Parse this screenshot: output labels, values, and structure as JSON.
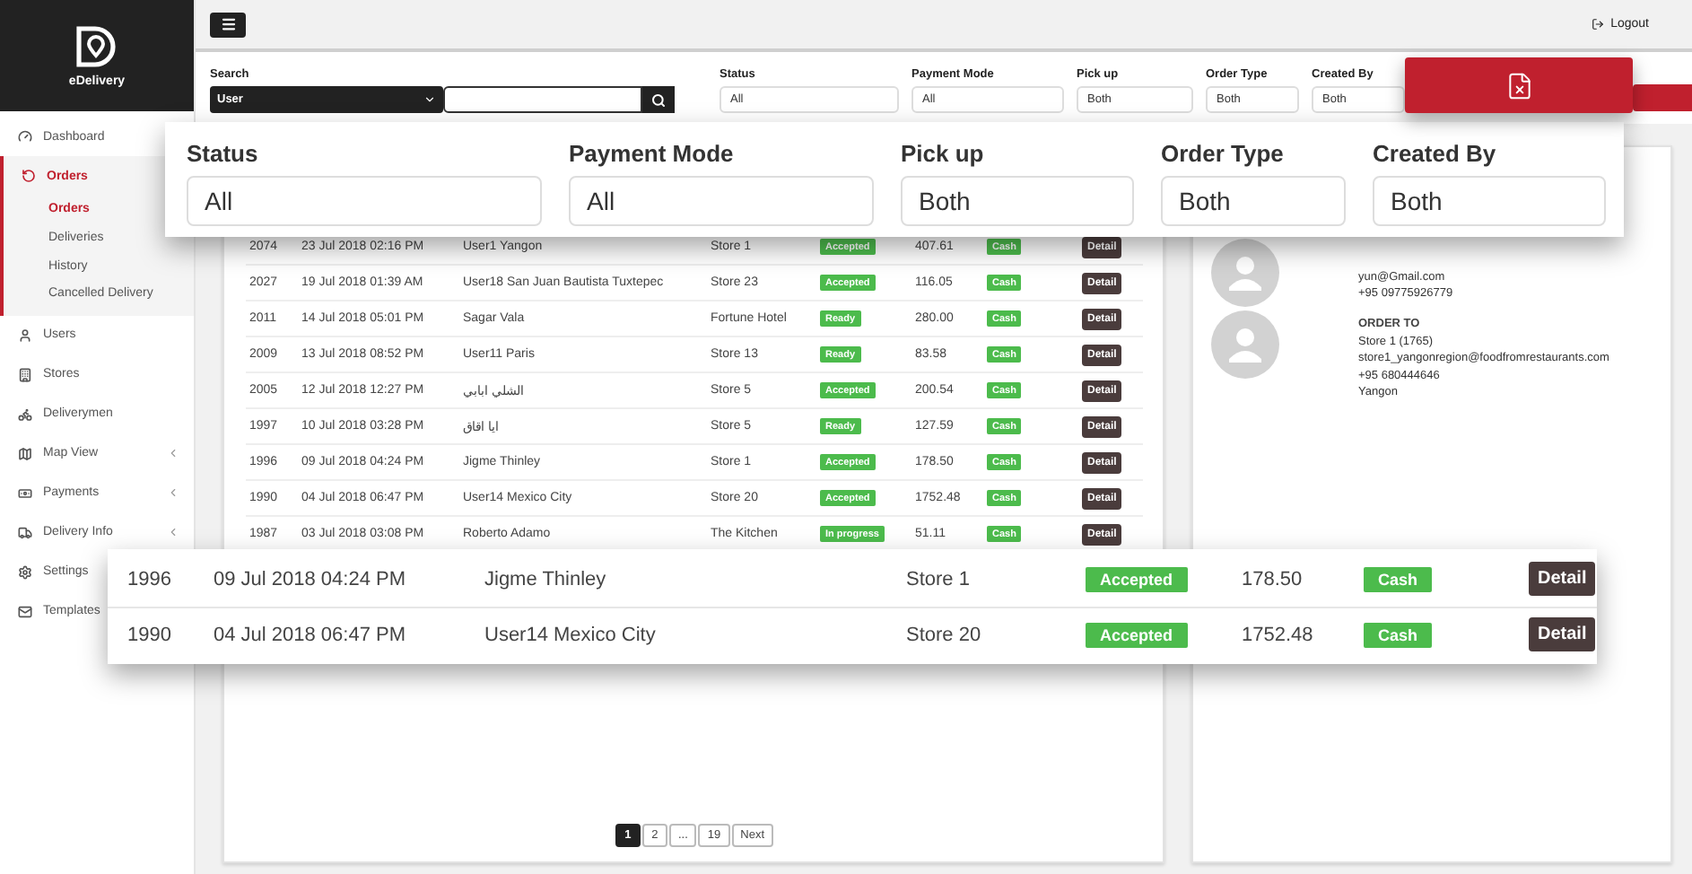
{
  "brand": {
    "name": "eDelivery"
  },
  "topbar": {
    "logout": "Logout"
  },
  "sidebar": {
    "items": [
      {
        "label": "Dashboard",
        "selected": false,
        "expandable": false
      },
      {
        "label": "Orders",
        "selected": true,
        "expandable": false,
        "children": [
          {
            "label": "Orders",
            "selected": true
          },
          {
            "label": "Deliveries",
            "selected": false
          },
          {
            "label": "History",
            "selected": false
          },
          {
            "label": "Cancelled Delivery",
            "selected": false
          }
        ]
      },
      {
        "label": "Users",
        "selected": false,
        "expandable": false
      },
      {
        "label": "Stores",
        "selected": false,
        "expandable": false
      },
      {
        "label": "Deliverymen",
        "selected": false,
        "expandable": false
      },
      {
        "label": "Map View",
        "selected": false,
        "expandable": true
      },
      {
        "label": "Payments",
        "selected": false,
        "expandable": true
      },
      {
        "label": "Delivery Info",
        "selected": false,
        "expandable": true
      },
      {
        "label": "Settings",
        "selected": false,
        "expandable": false
      },
      {
        "label": "Templates",
        "selected": false,
        "expandable": false
      }
    ]
  },
  "filters": {
    "search": {
      "label": "Search",
      "scope": "User"
    },
    "fields": [
      {
        "label": "Status",
        "value": "All"
      },
      {
        "label": "Payment Mode",
        "value": "All"
      },
      {
        "label": "Pick up",
        "value": "Both"
      },
      {
        "label": "Order Type",
        "value": "Both"
      },
      {
        "label": "Created By",
        "value": "Both"
      }
    ]
  },
  "orders": {
    "rows": [
      {
        "id": "2074",
        "date": "23 Jul 2018 02:16 PM",
        "customer": "User1 Yangon",
        "store": "Store 1",
        "status": "Accepted",
        "amount": "407.61",
        "payment": "Cash",
        "action": "Detail"
      },
      {
        "id": "2027",
        "date": "19 Jul 2018 01:39 AM",
        "customer": "User18 San Juan Bautista Tuxtepec",
        "store": "Store 23",
        "status": "Accepted",
        "amount": "116.05",
        "payment": "Cash",
        "action": "Detail"
      },
      {
        "id": "2011",
        "date": "14 Jul 2018 05:01 PM",
        "customer": "Sagar Vala",
        "store": "Fortune Hotel",
        "status": "Ready",
        "amount": "280.00",
        "payment": "Cash",
        "action": "Detail"
      },
      {
        "id": "2009",
        "date": "13 Jul 2018 08:52 PM",
        "customer": "User11 Paris",
        "store": "Store 13",
        "status": "Ready",
        "amount": "83.58",
        "payment": "Cash",
        "action": "Detail"
      },
      {
        "id": "2005",
        "date": "12 Jul 2018 12:27 PM",
        "customer": "الشلي ابابي",
        "store": "Store 5",
        "status": "Accepted",
        "amount": "200.54",
        "payment": "Cash",
        "action": "Detail"
      },
      {
        "id": "1997",
        "date": "10 Jul 2018 03:28 PM",
        "customer": "ايا اقاق",
        "store": "Store 5",
        "status": "Ready",
        "amount": "127.59",
        "payment": "Cash",
        "action": "Detail"
      },
      {
        "id": "1996",
        "date": "09 Jul 2018 04:24 PM",
        "customer": "Jigme Thinley",
        "store": "Store 1",
        "status": "Accepted",
        "amount": "178.50",
        "payment": "Cash",
        "action": "Detail"
      },
      {
        "id": "1990",
        "date": "04 Jul 2018 06:47 PM",
        "customer": "User14 Mexico City",
        "store": "Store 20",
        "status": "Accepted",
        "amount": "1752.48",
        "payment": "Cash",
        "action": "Detail"
      },
      {
        "id": "1987",
        "date": "03 Jul 2018 03:08 PM",
        "customer": "Roberto Adamo",
        "store": "The Kitchen",
        "status": "In progress",
        "amount": "51.11",
        "payment": "Cash",
        "action": "Detail"
      }
    ],
    "pagination": [
      {
        "label": "1",
        "selected": true
      },
      {
        "label": "2",
        "selected": false
      },
      {
        "label": "...",
        "selected": false
      },
      {
        "label": "19",
        "selected": false
      },
      {
        "label": "Next",
        "selected": false
      }
    ]
  },
  "order_detail": {
    "contacts": [
      {
        "lines": [
          "yun@Gmail.com",
          "+95 09775926779"
        ]
      },
      {
        "heading": "ORDER TO",
        "lines": [
          "Store 1 (1765)",
          "store1_yangonregion@foodfromrestaurants.com",
          "+95 680444646",
          "Yangon"
        ]
      }
    ]
  },
  "filters_callout": {
    "fields": [
      {
        "label": "Status",
        "value": "All"
      },
      {
        "label": "Payment Mode",
        "value": "All"
      },
      {
        "label": "Pick up",
        "value": "Both"
      },
      {
        "label": "Order Type",
        "value": "Both"
      },
      {
        "label": "Created By",
        "value": "Both"
      }
    ]
  },
  "rows_callout": {
    "rows": [
      {
        "id": "1996",
        "date": "09 Jul 2018 04:24 PM",
        "customer": "Jigme Thinley",
        "store": "Store 1",
        "status": "Accepted",
        "amount": "178.50",
        "payment": "Cash",
        "action": "Detail"
      },
      {
        "id": "1990",
        "date": "04 Jul 2018 06:47 PM",
        "customer": "User14 Mexico City",
        "store": "Store 20",
        "status": "Accepted",
        "amount": "1752.48",
        "payment": "Cash",
        "action": "Detail"
      }
    ]
  }
}
